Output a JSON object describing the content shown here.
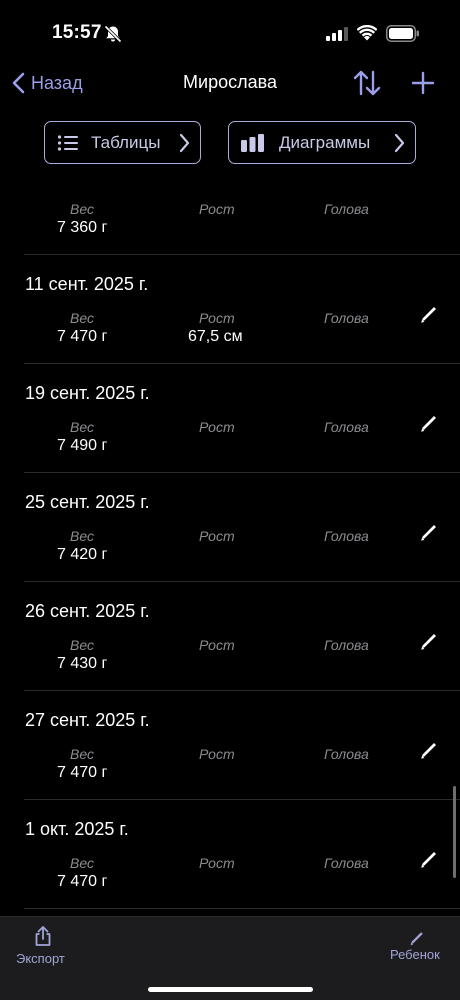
{
  "status_bar": {
    "time": "15:57",
    "icons": [
      "bell-slash-icon",
      "cellular-signal-icon",
      "wifi-icon",
      "battery-icon"
    ]
  },
  "nav": {
    "back_label": "Назад",
    "title": "Мирослава",
    "sort_icon": "sort-arrows-icon",
    "add_icon": "plus-icon"
  },
  "segments": {
    "tables_label": "Таблицы",
    "charts_label": "Диаграммы"
  },
  "columns": {
    "weight": "Вес",
    "height": "Рост",
    "head": "Голова"
  },
  "records": [
    {
      "date": "",
      "weight": "7 360 г",
      "height": "",
      "head": ""
    },
    {
      "date": "11 сент. 2025 г.",
      "weight": "7 470 г",
      "height": "67,5 см",
      "head": ""
    },
    {
      "date": "19 сент. 2025 г.",
      "weight": "7 490 г",
      "height": "",
      "head": ""
    },
    {
      "date": "25 сент. 2025 г.",
      "weight": "7 420 г",
      "height": "",
      "head": ""
    },
    {
      "date": "26 сент. 2025 г.",
      "weight": "7 430 г",
      "height": "",
      "head": ""
    },
    {
      "date": "27 сент. 2025 г.",
      "weight": "7 470 г",
      "height": "",
      "head": ""
    },
    {
      "date": "1 окт. 2025 г.",
      "weight": "7 470 г",
      "height": "",
      "head": ""
    }
  ],
  "tab_bar": {
    "export_label": "Экспорт",
    "child_label": "Ребенок"
  },
  "colors": {
    "background": "#000000",
    "accent": "#9b9ee8",
    "tab_bar": "#1c1c1e",
    "muted_label": "#8b8b90"
  }
}
